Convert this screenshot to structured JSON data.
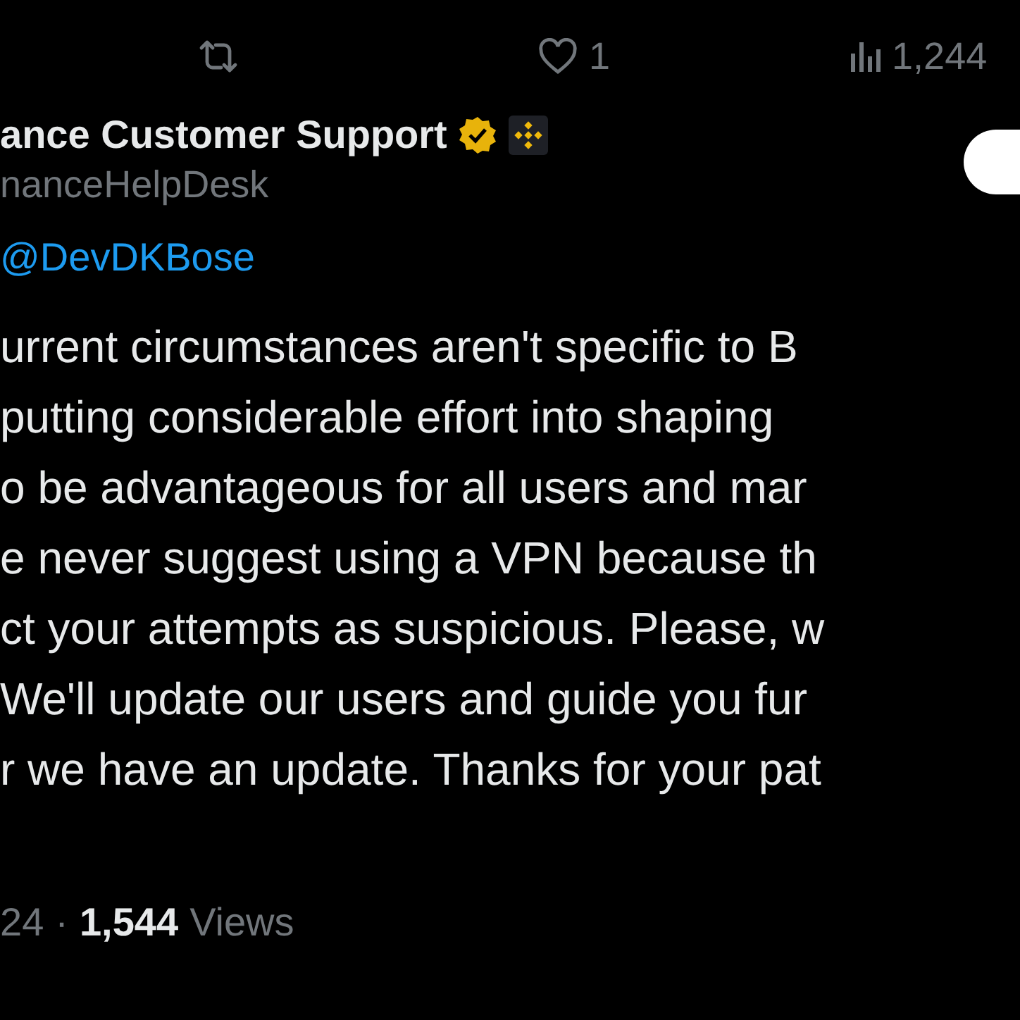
{
  "action_bar": {
    "like_count": "1",
    "view_count": "1,244"
  },
  "reply": {
    "author_name": "ance Customer Support",
    "handle": "nanceHelpDesk",
    "verified": true,
    "follow_button": true,
    "replying_to": "@DevDKBose",
    "body_lines": [
      "urrent circumstances aren't specific to B",
      "putting considerable effort into shaping",
      "o be advantageous for all users and mar",
      "e never suggest using a VPN because th",
      "ct your attempts as suspicious. Please, w",
      "We'll update our users and guide you fur",
      "r we have an update. Thanks for your pat"
    ],
    "meta": {
      "time": "24",
      "separator": "·",
      "views_count": "1,544",
      "views_label": "Views"
    }
  }
}
